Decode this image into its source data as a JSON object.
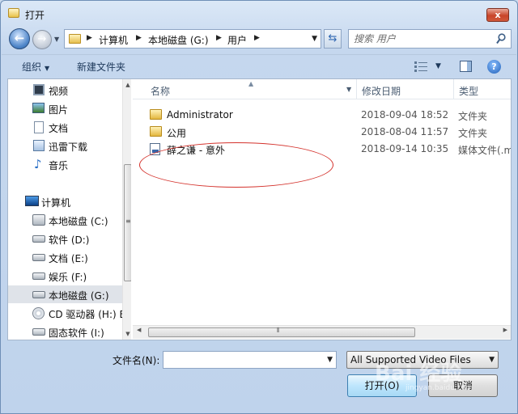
{
  "window": {
    "title": "打开",
    "close_glyph": "x"
  },
  "nav": {
    "back_glyph": "←",
    "forward_glyph": "→"
  },
  "address": {
    "crumbs": [
      "计算机",
      "本地磁盘 (G:)",
      "用户"
    ]
  },
  "search": {
    "placeholder": "搜索 用户"
  },
  "toolbar": {
    "organize": "组织",
    "new_folder": "新建文件夹",
    "help": "?"
  },
  "sidebar": {
    "items": [
      {
        "label": "视频",
        "icon": "video-library-icon"
      },
      {
        "label": "图片",
        "icon": "picture-library-icon"
      },
      {
        "label": "文档",
        "icon": "document-library-icon"
      },
      {
        "label": "迅雷下载",
        "icon": "download-folder-icon"
      },
      {
        "label": "音乐",
        "icon": "music-library-icon"
      },
      {
        "label": "计算机",
        "icon": "computer-icon"
      },
      {
        "label": "本地磁盘 (C:)",
        "icon": "system-drive-icon"
      },
      {
        "label": "软件 (D:)",
        "icon": "drive-icon"
      },
      {
        "label": "文档 (E:)",
        "icon": "drive-icon"
      },
      {
        "label": "娱乐 (F:)",
        "icon": "drive-icon"
      },
      {
        "label": "本地磁盘 (G:)",
        "icon": "drive-icon",
        "selected": true
      },
      {
        "label": "CD 驱动器 (H:) E",
        "icon": "cd-drive-icon"
      },
      {
        "label": "固态软件 (I:)",
        "icon": "drive-icon"
      }
    ]
  },
  "columns": {
    "name": "名称",
    "date": "修改日期",
    "type": "类型"
  },
  "files": [
    {
      "name": "Administrator",
      "date": "2018-09-04 18:52",
      "type": "文件夹",
      "icon": "folder-icon"
    },
    {
      "name": "公用",
      "date": "2018-08-04 11:57",
      "type": "文件夹",
      "icon": "folder-icon"
    },
    {
      "name": "薛之谦 - 意外",
      "date": "2018-09-14 10:35",
      "type": "媒体文件(.m",
      "icon": "media-file-icon"
    }
  ],
  "bottom": {
    "filename_label": "文件名(N):",
    "filename_value": "",
    "filetype_value": "All Supported Video Files",
    "open_label": "打开(O)",
    "cancel_label": "取消"
  },
  "watermark": {
    "text": "Bai 经验",
    "sub": "jingyan.baidu.com"
  },
  "colors": {
    "annotation": "#d4322c",
    "selection": "#dfe3e9",
    "primary_button": "#bee6fd"
  }
}
